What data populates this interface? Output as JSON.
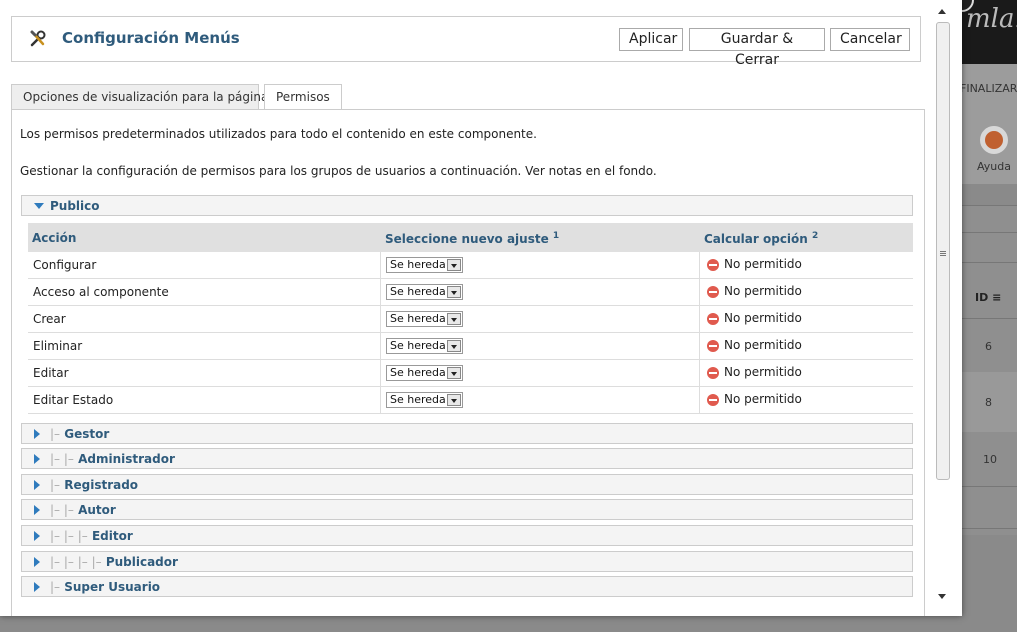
{
  "background": {
    "logo_text": "mla!",
    "toolbar_label": "FINALIZAR",
    "help_label": "Ayuda",
    "id_header": "ID",
    "id_values": [
      "6",
      "8",
      "10"
    ]
  },
  "header": {
    "title": "Configuración Menús",
    "buttons": {
      "apply": "Aplicar",
      "save_close": "Guardar & Cerrar",
      "cancel": "Cancelar"
    }
  },
  "tabs": [
    {
      "label": "Opciones de visualización para la página",
      "active": false
    },
    {
      "label": "Permisos",
      "active": true
    }
  ],
  "panel": {
    "description_1": "Los permisos predeterminados utilizados para todo el contenido en este componente.",
    "description_2": "Gestionar la configuración de permisos para los grupos de usuarios a continuación. Ver notas en el fondo."
  },
  "expanded_group": {
    "name": "Publico",
    "columns": {
      "action": "Acción",
      "new_setting": "Seleccione nuevo ajuste",
      "new_setting_note": "1",
      "calculated": "Calcular opción",
      "calculated_note": "2"
    },
    "rows": [
      {
        "action": "Configurar",
        "setting": "Se hereda",
        "calculated": "No permitido"
      },
      {
        "action": "Acceso al componente",
        "setting": "Se hereda",
        "calculated": "No permitido"
      },
      {
        "action": "Crear",
        "setting": "Se hereda",
        "calculated": "No permitido"
      },
      {
        "action": "Eliminar",
        "setting": "Se hereda",
        "calculated": "No permitido"
      },
      {
        "action": "Editar",
        "setting": "Se hereda",
        "calculated": "No permitido"
      },
      {
        "action": "Editar Estado",
        "setting": "Se hereda",
        "calculated": "No permitido"
      }
    ]
  },
  "collapsed_groups": [
    {
      "prefix": "|–",
      "name": "Gestor"
    },
    {
      "prefix": "|– |–",
      "name": "Administrador"
    },
    {
      "prefix": "|–",
      "name": "Registrado"
    },
    {
      "prefix": "|– |–",
      "name": "Autor"
    },
    {
      "prefix": "|– |– |–",
      "name": "Editor"
    },
    {
      "prefix": "|– |– |– |–",
      "name": "Publicador"
    },
    {
      "prefix": "|–",
      "name": "Super Usuario"
    }
  ],
  "colors": {
    "title": "#2f5b7c",
    "arrow": "#2f7bbd",
    "deny": "#e05a4e"
  }
}
